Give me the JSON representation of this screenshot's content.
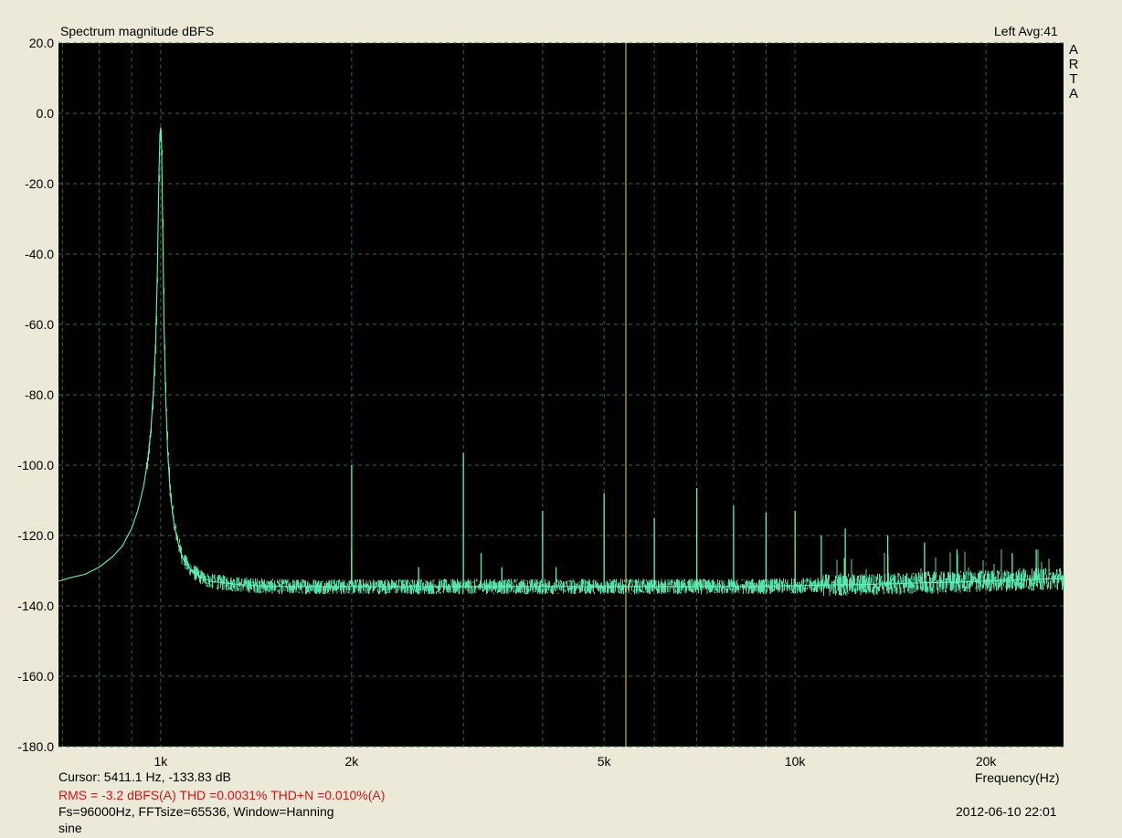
{
  "header": {
    "title": "Spectrum magnitude dBFS",
    "channel_avg": "Left  Avg:41",
    "brand": [
      "A",
      "R",
      "T",
      "A"
    ]
  },
  "footer": {
    "cursor": "Cursor:  5411.1 Hz, -133.83 dB",
    "measurement": "RMS =   -3.2 dBFS(A)   THD =0.0031%   THD+N =0.010%(A)",
    "settings": "Fs=96000Hz, FFTsize=65536, Window=Hanning",
    "note": "sine",
    "xlabel": "Frequency(Hz)",
    "timestamp": "2012-06-10  22:01"
  },
  "colors": {
    "trace": "#5ff5b8",
    "cursor": "#e8d060",
    "grid": "#2f6e38",
    "plot_bg": "#000000",
    "page_bg": "#ece9d8",
    "stats_text": "#d21414"
  },
  "chart_data": {
    "type": "line",
    "title": "Spectrum magnitude dBFS",
    "xlabel": "Frequency(Hz)",
    "ylabel": "",
    "x_scale": "log",
    "xlim": [
      690,
      26500
    ],
    "ylim": [
      -180,
      20
    ],
    "y_ticks": [
      20,
      0,
      -20,
      -40,
      -60,
      -80,
      -100,
      -120,
      -140,
      -160,
      -180
    ],
    "y_tick_labels": [
      "20.0",
      "0.0",
      "-20.0",
      "-40.0",
      "-60.0",
      "-80.0",
      "-100.0",
      "-120.0",
      "-140.0",
      "-160.0",
      "-180.0"
    ],
    "x_tick_labels": [
      {
        "value": 1000,
        "label": "1k"
      },
      {
        "value": 2000,
        "label": "2k"
      },
      {
        "value": 5000,
        "label": "5k"
      },
      {
        "value": 10000,
        "label": "10k"
      },
      {
        "value": 20000,
        "label": "20k"
      }
    ],
    "x_grid": [
      700,
      800,
      900,
      1000,
      2000,
      3000,
      4000,
      5000,
      6000,
      7000,
      8000,
      9000,
      10000,
      20000
    ],
    "grid": true,
    "cursor_hz": 5411.1,
    "noise_floor_db": -134,
    "series": [
      {
        "x": [
          690,
          720,
          760,
          800,
          840,
          870,
          900,
          920,
          940,
          955,
          965,
          975,
          982,
          988,
          993,
          997,
          1000,
          1003,
          1007,
          1012,
          1018,
          1025,
          1035,
          1050,
          1065,
          1080,
          1100,
          1130,
          1160,
          1200,
          1260,
          1350,
          1500,
          1700,
          1900,
          2100,
          2400,
          2700,
          3000,
          3300,
          3700,
          4200,
          4700,
          5200,
          5800,
          6500,
          7200,
          8000,
          8800,
          9600,
          10500,
          11500,
          12500,
          13500,
          14500,
          15500,
          16500,
          17500,
          18500,
          19500,
          20500,
          21500,
          22500,
          23500,
          24500,
          25500,
          26500
        ],
        "y": [
          -133,
          -132,
          -131,
          -129,
          -126,
          -123,
          -118,
          -113,
          -106,
          -98,
          -90,
          -78,
          -65,
          -45,
          -20,
          -6,
          -4,
          -8,
          -30,
          -60,
          -80,
          -95,
          -108,
          -117,
          -122,
          -126,
          -128.5,
          -130.5,
          -132,
          -133,
          -133.5,
          -134,
          -134.5,
          -134.5,
          -134.5,
          -134.5,
          -134.5,
          -134.5,
          -134.5,
          -134.5,
          -134.5,
          -134.5,
          -134.5,
          -134.5,
          -134.5,
          -134.5,
          -134.5,
          -134.5,
          -134.5,
          -134.3,
          -134.2,
          -134,
          -134,
          -133.8,
          -133.7,
          -133.5,
          -133.4,
          -133.3,
          -133.2,
          -133,
          -132.8,
          -132.7,
          -132.6,
          -132.5,
          -132.4,
          -132.3,
          -132.3
        ]
      }
    ],
    "harmonics": [
      {
        "hz": 2000,
        "db": -100
      },
      {
        "hz": 3000,
        "db": -96.5
      },
      {
        "hz": 4000,
        "db": -113
      },
      {
        "hz": 5000,
        "db": -108
      },
      {
        "hz": 6000,
        "db": -115
      },
      {
        "hz": 7000,
        "db": -106.5
      },
      {
        "hz": 8000,
        "db": -111.5
      },
      {
        "hz": 9000,
        "db": -113.5
      },
      {
        "hz": 10000,
        "db": -113
      },
      {
        "hz": 11000,
        "db": -120
      },
      {
        "hz": 12000,
        "db": -118
      },
      {
        "hz": 14000,
        "db": -120
      },
      {
        "hz": 16000,
        "db": -122
      },
      {
        "hz": 18000,
        "db": -124
      },
      {
        "hz": 22000,
        "db": -125
      },
      {
        "hz": 24000,
        "db": -124
      }
    ],
    "minor_spurs": [
      {
        "hz": 2000,
        "db": -124
      },
      {
        "hz": 3200,
        "db": -125
      },
      {
        "hz": 4200,
        "db": -129
      },
      {
        "hz": 2550,
        "db": -129
      },
      {
        "hz": 3450,
        "db": -129
      }
    ]
  }
}
